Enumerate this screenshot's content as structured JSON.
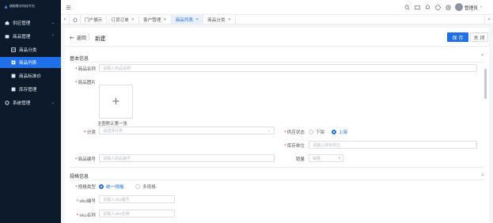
{
  "brand": {
    "title": "稀鲜数字科技平台"
  },
  "sidebar": {
    "items": [
      {
        "label": "供应管理",
        "icon": "supply-icon",
        "expand": "chevron-down-icon"
      },
      {
        "label": "商品管理",
        "icon": "goods-icon",
        "expand": "chevron-up-icon"
      },
      {
        "label": "商品分类",
        "icon": "category-icon"
      },
      {
        "label": "商品列表",
        "icon": "list-icon",
        "active": true
      },
      {
        "label": "商品标准价",
        "icon": "price-icon"
      },
      {
        "label": "库存管理",
        "icon": "stock-icon"
      },
      {
        "label": "系统管理",
        "icon": "system-icon",
        "expand": "chevron-down-icon"
      }
    ]
  },
  "topbar": {
    "menu_icon": "menu-fold-icon",
    "icons": [
      "search-icon",
      "message-icon",
      "bell-icon",
      "help-icon",
      "settings-icon"
    ],
    "user": "管理员",
    "user_chev": "chevron-down-icon"
  },
  "tabs": [
    {
      "label": "门户展示",
      "closable": false
    },
    {
      "label": "订货订单",
      "closable": true
    },
    {
      "label": "客户管理",
      "closable": true
    },
    {
      "label": "商品列表",
      "closable": true,
      "active": true
    },
    {
      "label": "商品分类",
      "closable": true
    }
  ],
  "page": {
    "back": "返回",
    "title": "新建",
    "save": "保 存",
    "close": "关 闭"
  },
  "basic": {
    "title": "基本信息",
    "name_label": "商品名称",
    "name_ph": "请输入商品名称",
    "image_label": "商品图片",
    "upload_plus": "+",
    "image_hint": "主图默认第一张",
    "category_label": "分类",
    "category_ph": "请选择分类",
    "status_label": "供应状态",
    "status_options": [
      "下架",
      "上架"
    ],
    "status_selected": "上架",
    "unit_label": "库存单位",
    "unit_ph": "请输入库存单位",
    "code_label": "商品编号",
    "code_ph": "请输入商品编号",
    "sales_label": "销量",
    "sales_ph": "销量"
  },
  "spec": {
    "title": "规格信息",
    "type_label": "规格类型",
    "type_options": [
      "统一规格",
      "多规格"
    ],
    "type_selected": "统一规格",
    "sku_code_label": "sku编号",
    "sku_code_ph": "请输入sku编号",
    "sku_name_label": "sku名称",
    "sku_name_ph": "请输入sku名称"
  },
  "colors": {
    "primary": "#1e6fe8",
    "sidebar_bg": "#0c1a2c",
    "required": "#e53935"
  }
}
